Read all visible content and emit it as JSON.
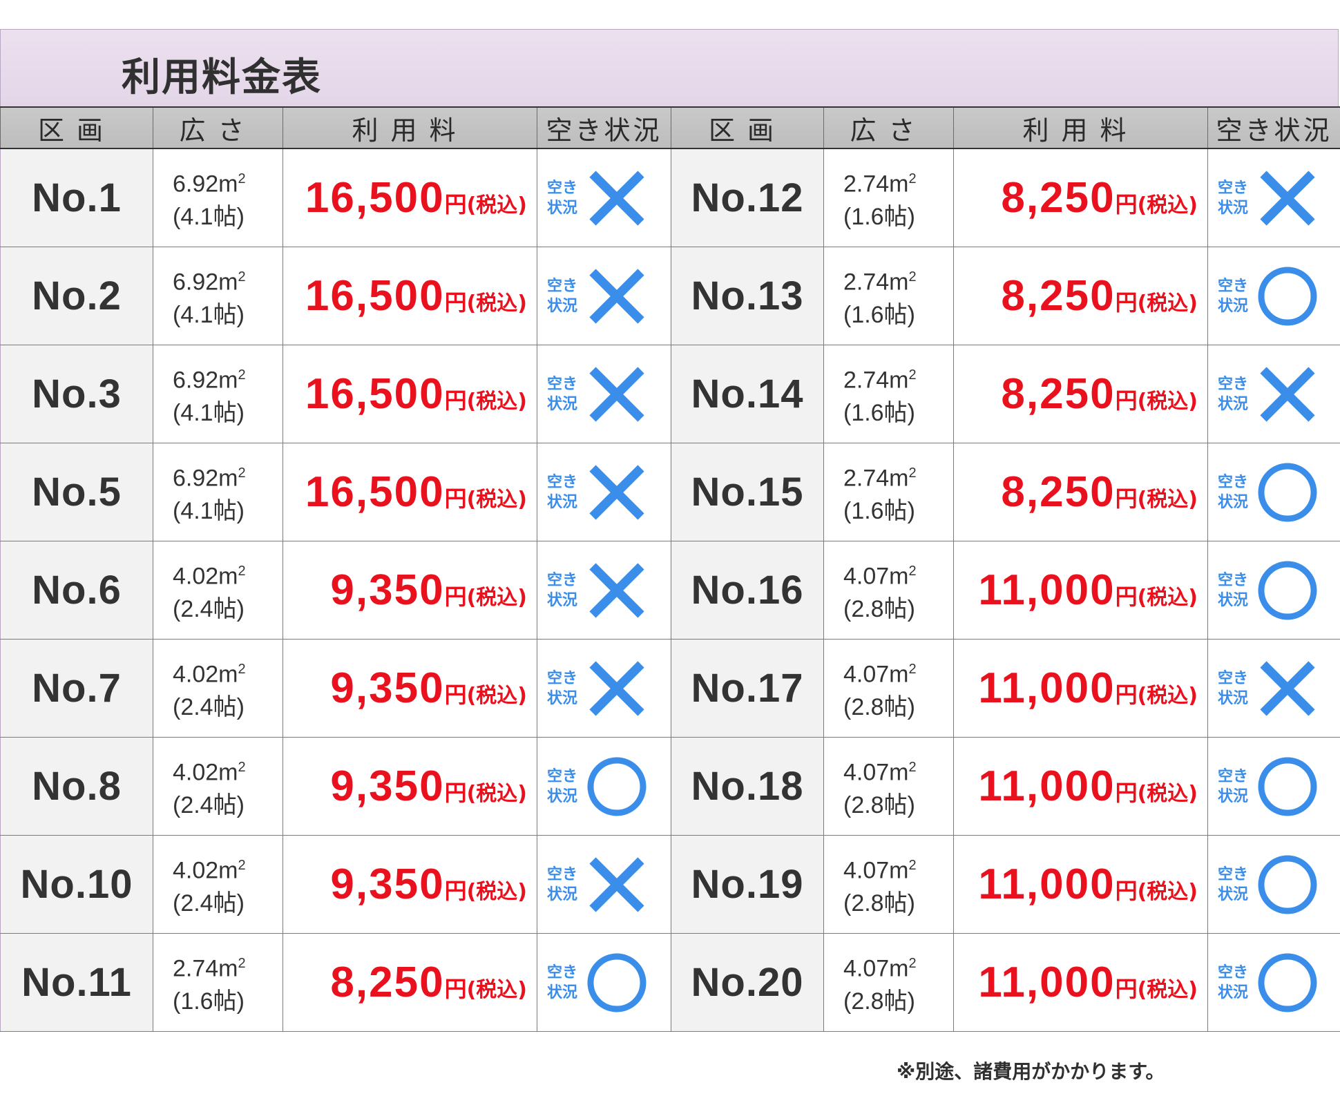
{
  "title": "利用料金表",
  "headers": {
    "section": "区画",
    "size": "広さ",
    "fee": "利用料",
    "status": "空き状況"
  },
  "status_label_line1": "空き",
  "status_label_line2": "状況",
  "price_unit": "円",
  "price_tax": "(税込)",
  "left": [
    {
      "no": "No.1",
      "m2": "6.92m",
      "jo": "(4.1帖)",
      "price": "16,500",
      "available": false
    },
    {
      "no": "No.2",
      "m2": "6.92m",
      "jo": "(4.1帖)",
      "price": "16,500",
      "available": false
    },
    {
      "no": "No.3",
      "m2": "6.92m",
      "jo": "(4.1帖)",
      "price": "16,500",
      "available": false
    },
    {
      "no": "No.5",
      "m2": "6.92m",
      "jo": "(4.1帖)",
      "price": "16,500",
      "available": false
    },
    {
      "no": "No.6",
      "m2": "4.02m",
      "jo": "(2.4帖)",
      "price": "9,350",
      "available": false
    },
    {
      "no": "No.7",
      "m2": "4.02m",
      "jo": "(2.4帖)",
      "price": "9,350",
      "available": false
    },
    {
      "no": "No.8",
      "m2": "4.02m",
      "jo": "(2.4帖)",
      "price": "9,350",
      "available": true
    },
    {
      "no": "No.10",
      "m2": "4.02m",
      "jo": "(2.4帖)",
      "price": "9,350",
      "available": false
    },
    {
      "no": "No.11",
      "m2": "2.74m",
      "jo": "(1.6帖)",
      "price": "8,250",
      "available": true
    }
  ],
  "right": [
    {
      "no": "No.12",
      "m2": "2.74m",
      "jo": "(1.6帖)",
      "price": "8,250",
      "available": false
    },
    {
      "no": "No.13",
      "m2": "2.74m",
      "jo": "(1.6帖)",
      "price": "8,250",
      "available": true
    },
    {
      "no": "No.14",
      "m2": "2.74m",
      "jo": "(1.6帖)",
      "price": "8,250",
      "available": false
    },
    {
      "no": "No.15",
      "m2": "2.74m",
      "jo": "(1.6帖)",
      "price": "8,250",
      "available": true
    },
    {
      "no": "No.16",
      "m2": "4.07m",
      "jo": "(2.8帖)",
      "price": "11,000",
      "available": true
    },
    {
      "no": "No.17",
      "m2": "4.07m",
      "jo": "(2.8帖)",
      "price": "11,000",
      "available": false
    },
    {
      "no": "No.18",
      "m2": "4.07m",
      "jo": "(2.8帖)",
      "price": "11,000",
      "available": true
    },
    {
      "no": "No.19",
      "m2": "4.07m",
      "jo": "(2.8帖)",
      "price": "11,000",
      "available": true
    },
    {
      "no": "No.20",
      "m2": "4.07m",
      "jo": "(2.8帖)",
      "price": "11,000",
      "available": true
    }
  ],
  "note": "※別途、諸費用がかかります。",
  "colors": {
    "price": "#e8111d",
    "status": "#3a8eea",
    "banner": "#e6daea"
  }
}
